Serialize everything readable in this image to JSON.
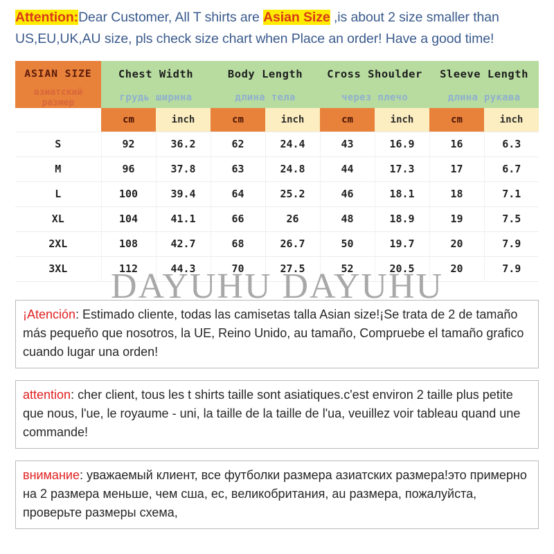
{
  "attention": {
    "label": "Attention:",
    "text_1": "Dear Customer, All T shirts are ",
    "highlight": "Asian Size",
    "text_2": " ,is about 2 size smaller than US,EU,UK,AU size, pls check size chart when Place an order! Have a good time!"
  },
  "table": {
    "size_column": {
      "title": "ASIAN SIZE",
      "subtitle": "азиатский размер"
    },
    "measure_columns": [
      {
        "title": "Chest Width",
        "subtitle": "грудь ширина"
      },
      {
        "title": "Body Length",
        "subtitle": "длина тела"
      },
      {
        "title": "Cross Shoulder",
        "subtitle": "через плечо"
      },
      {
        "title": "Sleeve Length",
        "subtitle": "длина рукава"
      }
    ],
    "units": {
      "cm": "cm",
      "inch": "inch"
    },
    "rows": [
      {
        "size": "S",
        "chest_cm": "92",
        "chest_in": "36.2",
        "body_cm": "62",
        "body_in": "24.4",
        "shoulder_cm": "43",
        "shoulder_in": "16.9",
        "sleeve_cm": "16",
        "sleeve_in": "6.3"
      },
      {
        "size": "M",
        "chest_cm": "96",
        "chest_in": "37.8",
        "body_cm": "63",
        "body_in": "24.8",
        "shoulder_cm": "44",
        "shoulder_in": "17.3",
        "sleeve_cm": "17",
        "sleeve_in": "6.7"
      },
      {
        "size": "L",
        "chest_cm": "100",
        "chest_in": "39.4",
        "body_cm": "64",
        "body_in": "25.2",
        "shoulder_cm": "46",
        "shoulder_in": "18.1",
        "sleeve_cm": "18",
        "sleeve_in": "7.1"
      },
      {
        "size": "XL",
        "chest_cm": "104",
        "chest_in": "41.1",
        "body_cm": "66",
        "body_in": "26",
        "shoulder_cm": "48",
        "shoulder_in": "18.9",
        "sleeve_cm": "19",
        "sleeve_in": "7.5"
      },
      {
        "size": "2XL",
        "chest_cm": "108",
        "chest_in": "42.7",
        "body_cm": "68",
        "body_in": "26.7",
        "shoulder_cm": "50",
        "shoulder_in": "19.7",
        "sleeve_cm": "20",
        "sleeve_in": "7.9"
      },
      {
        "size": "3XL",
        "chest_cm": "112",
        "chest_in": "44.3",
        "body_cm": "70",
        "body_in": "27.5",
        "shoulder_cm": "52",
        "shoulder_in": "20.5",
        "sleeve_cm": "20",
        "sleeve_in": "7.9"
      }
    ]
  },
  "watermark": "DAYUHU DAYUHU",
  "notices": [
    {
      "lead": "¡Atención",
      "body": ": Estimado cliente, todas las camisetas talla Asian size!¡Se trata de 2 de tamaño más pequeño que nosotros, la UE, Reino Unido, au tamaño, Compruebe el tamaño grafico cuando lugar una orden!"
    },
    {
      "lead": "attention",
      "body": ": cher client, tous les t shirts taille sont asiatiques.c'est environ 2 taille plus petite que nous, l'ue, le royaume - uni, la taille de la taille de l'ua, veuillez voir tableau quand une commande!"
    },
    {
      "lead": "внимание",
      "body": ": уважаемый клиент, все футболки размера азиатских размера!это примерно на 2 размера меньше, чем сша, ес, великобритания, au размера, пожалуйста, проверьте размеры схема,"
    }
  ],
  "colors": {
    "header_green": "#b8dca0",
    "orange": "#e8813a",
    "pale_yellow": "#fceec0",
    "highlight_yellow": "#ffeb00",
    "accent_red": "#d93a1a",
    "body_blue": "#3a5a8c",
    "notice_red": "#e02020"
  }
}
